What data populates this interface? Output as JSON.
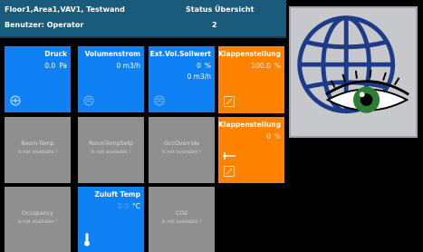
{
  "header": {
    "location": "Floor1,Area1,VAV1, Testwand",
    "title": "Status Übersicht",
    "user": "Benutzer: Operator",
    "number": "2"
  },
  "tiles": {
    "druck": {
      "label": "Druck",
      "value": "0.0",
      "unit": "Pa",
      "icon": "fan-icon"
    },
    "volumenstrom": {
      "label": "Volumenstrom",
      "value": "0 m3/h",
      "icon": "flow-icon"
    },
    "ext_vol": {
      "label": "Ext.Vol.Sollwert",
      "value": "0",
      "unit": "%",
      "value2": "0 m3/h",
      "icon": "flow-icon"
    },
    "klappe1": {
      "label": "Klappenstellung",
      "value": "100.0",
      "unit": "%",
      "icon": "damper-icon"
    },
    "klappe2": {
      "label": "Klappenstellung",
      "value": "0",
      "unit": "%",
      "icon": "damper-icon"
    },
    "room_temp": {
      "label": "Room-Temp",
      "status": "is not available !"
    },
    "room_temp_sp": {
      "label": "RoomTempSetp",
      "status": "is not available !"
    },
    "occ_override": {
      "label": "OccOverride",
      "status": "is not available !"
    },
    "occupancy": {
      "label": "Occupancy",
      "status": "is not available !"
    },
    "zuluft": {
      "label": "Zuluft Temp",
      "value": "0.0",
      "unit": "°C",
      "icon": "thermometer-icon"
    },
    "co2": {
      "label": "CO2",
      "status": "is not available !"
    }
  },
  "colors": {
    "header": "#1a5a7a",
    "blue_tile": "#1081f5",
    "orange_tile": "#ff8200",
    "gray_tile": "#8f8f8f",
    "logo_bg": "#c7c8cc"
  }
}
